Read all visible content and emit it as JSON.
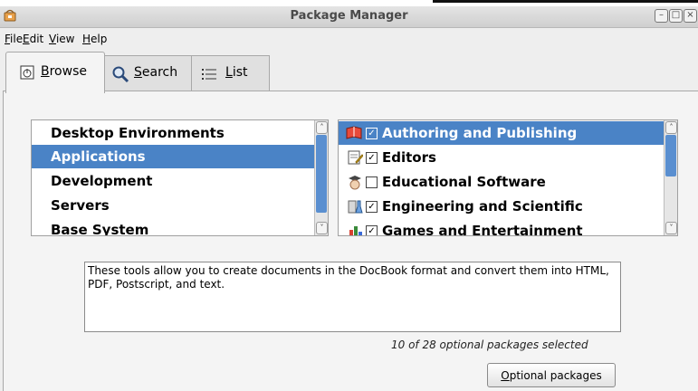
{
  "window": {
    "title": "Package Manager"
  },
  "menubar": [
    {
      "pre": "",
      "key": "F",
      "post": "ile"
    },
    {
      "pre": "",
      "key": "E",
      "post": "dit"
    },
    {
      "pre": "",
      "key": "V",
      "post": "iew"
    },
    {
      "pre": "",
      "key": "H",
      "post": "elp"
    }
  ],
  "tabs": [
    {
      "key": "B",
      "post": "rowse",
      "icon": "browse-icon",
      "active": true
    },
    {
      "key": "S",
      "post": "earch",
      "icon": "search-icon",
      "active": false
    },
    {
      "key": "L",
      "post": "ist",
      "icon": "list-icon",
      "active": false
    }
  ],
  "groups": {
    "items": [
      "Desktop Environments",
      "Applications",
      "Development",
      "Servers",
      "Base System"
    ],
    "selected": "Applications"
  },
  "categories": {
    "items": [
      {
        "label": "Authoring and Publishing",
        "checked": true,
        "icon": "book-icon"
      },
      {
        "label": "Editors",
        "checked": true,
        "icon": "editor-icon"
      },
      {
        "label": "Educational Software",
        "checked": false,
        "icon": "education-icon"
      },
      {
        "label": "Engineering and Scientific",
        "checked": true,
        "icon": "science-icon"
      },
      {
        "label": "Games and Entertainment",
        "checked": true,
        "icon": "games-icon"
      }
    ],
    "selected": "Authoring and Publishing"
  },
  "description": "These tools allow you to create documents in the DocBook format and convert them into HTML, PDF, Postscript, and text.",
  "status": "10 of 28 optional packages selected",
  "optional_button": {
    "key": "O",
    "post": "ptional packages"
  },
  "colors": {
    "selection": "#4a83c6",
    "scroll_thumb": "#5a8fd0"
  }
}
